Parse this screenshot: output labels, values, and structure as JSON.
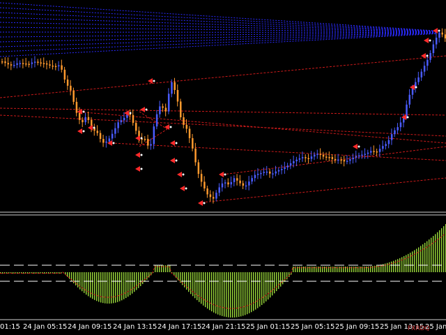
{
  "chart_data": {
    "type": "candlestick",
    "time_axis_labels": [
      "01:15",
      "24 Jan 05:15",
      "24 Jan 09:15",
      "24 Jan 13:15",
      "24 Jan 17:15",
      "24 Jan 21:15",
      "25 Jan 01:15",
      "25 Jan 05:15",
      "25 Jan 09:15",
      "25 Jan 13:15",
      "25 Jan"
    ],
    "colors": {
      "background": "#000000",
      "bull_candle": "#4a5cff",
      "bear_candle": "#ff9a2e",
      "arrow_marker": "#ff2a2a",
      "resistance_lines": "#2a2aff",
      "support_lines": "#cc1a1a",
      "histogram": "#9ad93a",
      "signal_line": "#cc1a1a",
      "level_lines": "#ffffff"
    },
    "price_path": [
      88,
      92,
      94,
      90,
      91,
      92,
      88,
      90,
      91,
      94,
      95,
      93,
      118,
      130,
      160,
      178,
      165,
      185,
      190,
      205,
      202,
      190,
      175,
      170,
      160,
      180,
      200,
      198,
      215,
      170,
      150,
      160,
      115,
      135,
      175,
      185,
      210,
      245,
      265,
      280,
      285,
      270,
      260,
      265,
      255,
      262,
      268,
      258,
      250,
      248,
      245,
      250,
      245,
      242,
      238,
      232,
      228,
      225,
      228,
      222,
      220,
      225,
      225,
      230,
      228,
      232,
      228,
      224,
      222,
      220,
      216,
      218,
      210,
      205,
      190,
      182,
      170,
      140,
      122,
      110,
      95,
      80,
      58,
      45,
      55
    ]
  },
  "watermark": "FXRDQ"
}
